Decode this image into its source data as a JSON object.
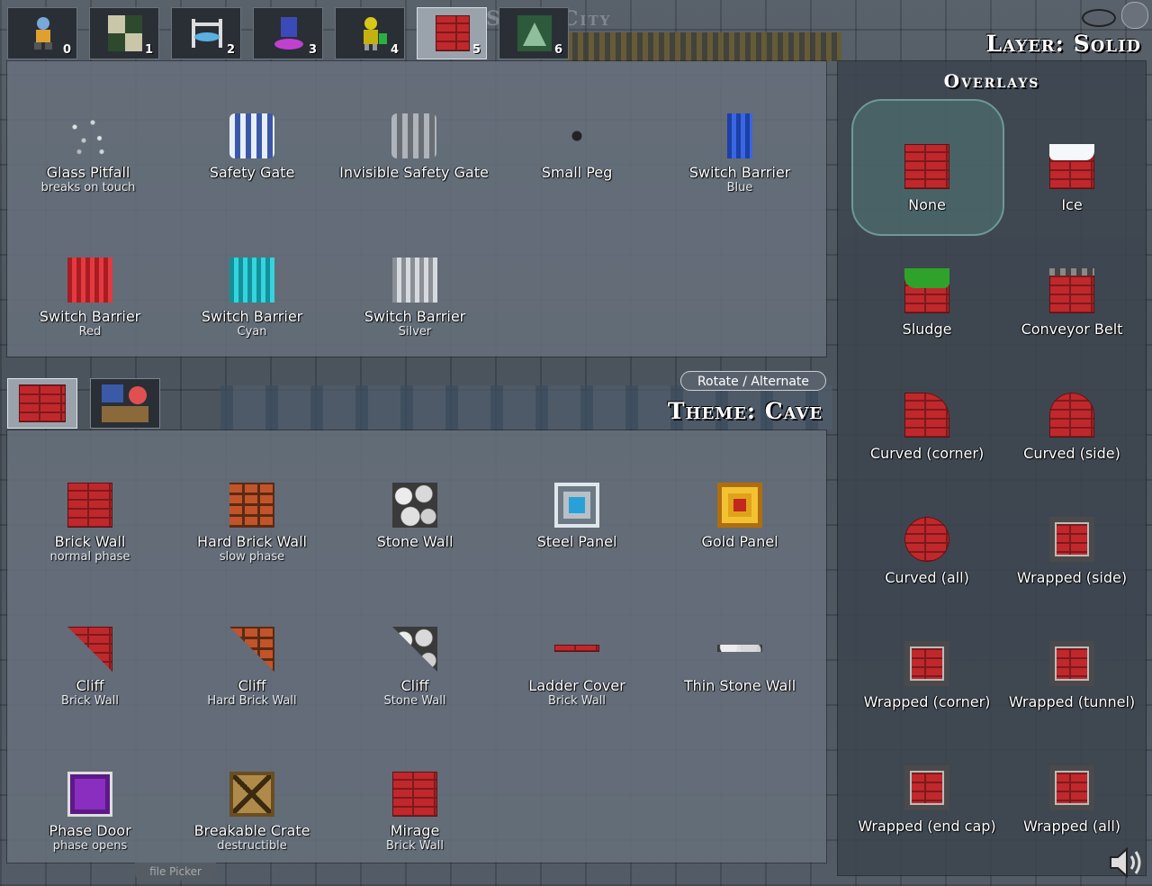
{
  "background": {
    "title": "Stone City",
    "footer_tab": "file Picker"
  },
  "toolbar": {
    "tabs": [
      {
        "num": "0",
        "icon": "player-icon"
      },
      {
        "num": "1",
        "icon": "terrain-icon"
      },
      {
        "num": "2",
        "icon": "platform-icon"
      },
      {
        "num": "3",
        "icon": "teleporter-icon"
      },
      {
        "num": "4",
        "icon": "robot-icon"
      },
      {
        "num": "5",
        "icon": "brick-icon",
        "active": true
      },
      {
        "num": "6",
        "icon": "background-icon"
      }
    ]
  },
  "layer_title": "Layer: Solid",
  "upper_items": [
    {
      "label": "Glass Pitfall",
      "sub": "breaks on touch"
    },
    {
      "label": "Safety Gate",
      "sub": ""
    },
    {
      "label": "Invisible Safety Gate",
      "sub": ""
    },
    {
      "label": "Small Peg",
      "sub": ""
    },
    {
      "label": "Switch Barrier",
      "sub": "Blue"
    },
    {
      "label": "Switch Barrier",
      "sub": "Red"
    },
    {
      "label": "Switch Barrier",
      "sub": "Cyan"
    },
    {
      "label": "Switch Barrier",
      "sub": "Silver"
    }
  ],
  "rotate_button": "Rotate / Alternate",
  "theme_title": "Theme: Cave",
  "lower_items": [
    {
      "label": "Brick Wall",
      "sub": "normal phase"
    },
    {
      "label": "Hard Brick Wall",
      "sub": "slow phase"
    },
    {
      "label": "Stone Wall",
      "sub": ""
    },
    {
      "label": "Steel Panel",
      "sub": ""
    },
    {
      "label": "Gold Panel",
      "sub": ""
    },
    {
      "label": "Cliff",
      "sub": "Brick Wall"
    },
    {
      "label": "Cliff",
      "sub": "Hard Brick Wall"
    },
    {
      "label": "Cliff",
      "sub": "Stone Wall"
    },
    {
      "label": "Ladder Cover",
      "sub": "Brick Wall"
    },
    {
      "label": "Thin Stone Wall",
      "sub": ""
    },
    {
      "label": "Phase Door",
      "sub": "phase opens"
    },
    {
      "label": "Breakable Crate",
      "sub": "destructible"
    },
    {
      "label": "Mirage",
      "sub": "Brick Wall"
    }
  ],
  "overlays": {
    "title": "Overlays",
    "items": [
      {
        "label": "None",
        "selected": true
      },
      {
        "label": "Ice"
      },
      {
        "label": "Sludge"
      },
      {
        "label": "Conveyor Belt"
      },
      {
        "label": "Curved (corner)"
      },
      {
        "label": "Curved (side)"
      },
      {
        "label": "Curved (all)"
      },
      {
        "label": "Wrapped (side)"
      },
      {
        "label": "Wrapped (corner)"
      },
      {
        "label": "Wrapped (tunnel)"
      },
      {
        "label": "Wrapped (end cap)"
      },
      {
        "label": "Wrapped (all)"
      }
    ]
  }
}
